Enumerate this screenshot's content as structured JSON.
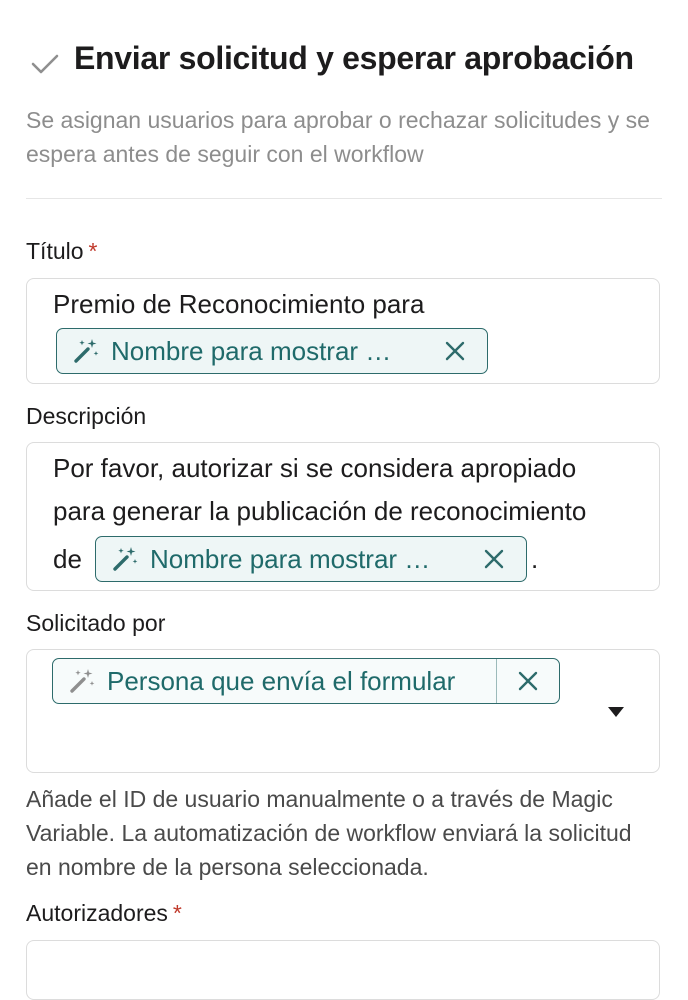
{
  "header": {
    "title": "Enviar solicitud y esperar aprobación",
    "subtitle": "Se asignan usuarios para aprobar o rechazar solicitudes y se espera antes de seguir con el workflow",
    "check_icon": "checkmark-icon"
  },
  "fields": {
    "titulo": {
      "label": "Título",
      "required_mark": "*",
      "text": "Premio de Reconocimiento para",
      "chip_label": "Nombre para mostrar …"
    },
    "descripcion": {
      "label": "Descripción",
      "line1": "Por favor, autorizar si se considera apropiado",
      "line2": "para generar la publicación de reconocimiento",
      "line3_prefix": "de",
      "chip_label": "Nombre para mostrar …",
      "line3_suffix": "."
    },
    "solicitado_por": {
      "label": "Solicitado por",
      "chip_label": "Persona que envía el formular",
      "help": "Añade el ID de usuario manualmente o a través de Magic Variable. La automatización de workflow enviará la solicitud en nombre de la persona seleccionada."
    },
    "autorizadores": {
      "label": "Autorizadores",
      "required_mark": "*"
    }
  },
  "icons": {
    "chip_icon": "magic-wand-icon",
    "remove_icon": "close-icon",
    "dropdown_icon": "caret-down-icon"
  },
  "colors": {
    "chip_border": "#2d6b6b",
    "chip_text": "#1f6a6a",
    "required": "#c0392b",
    "muted_text": "#8d8d8d"
  }
}
